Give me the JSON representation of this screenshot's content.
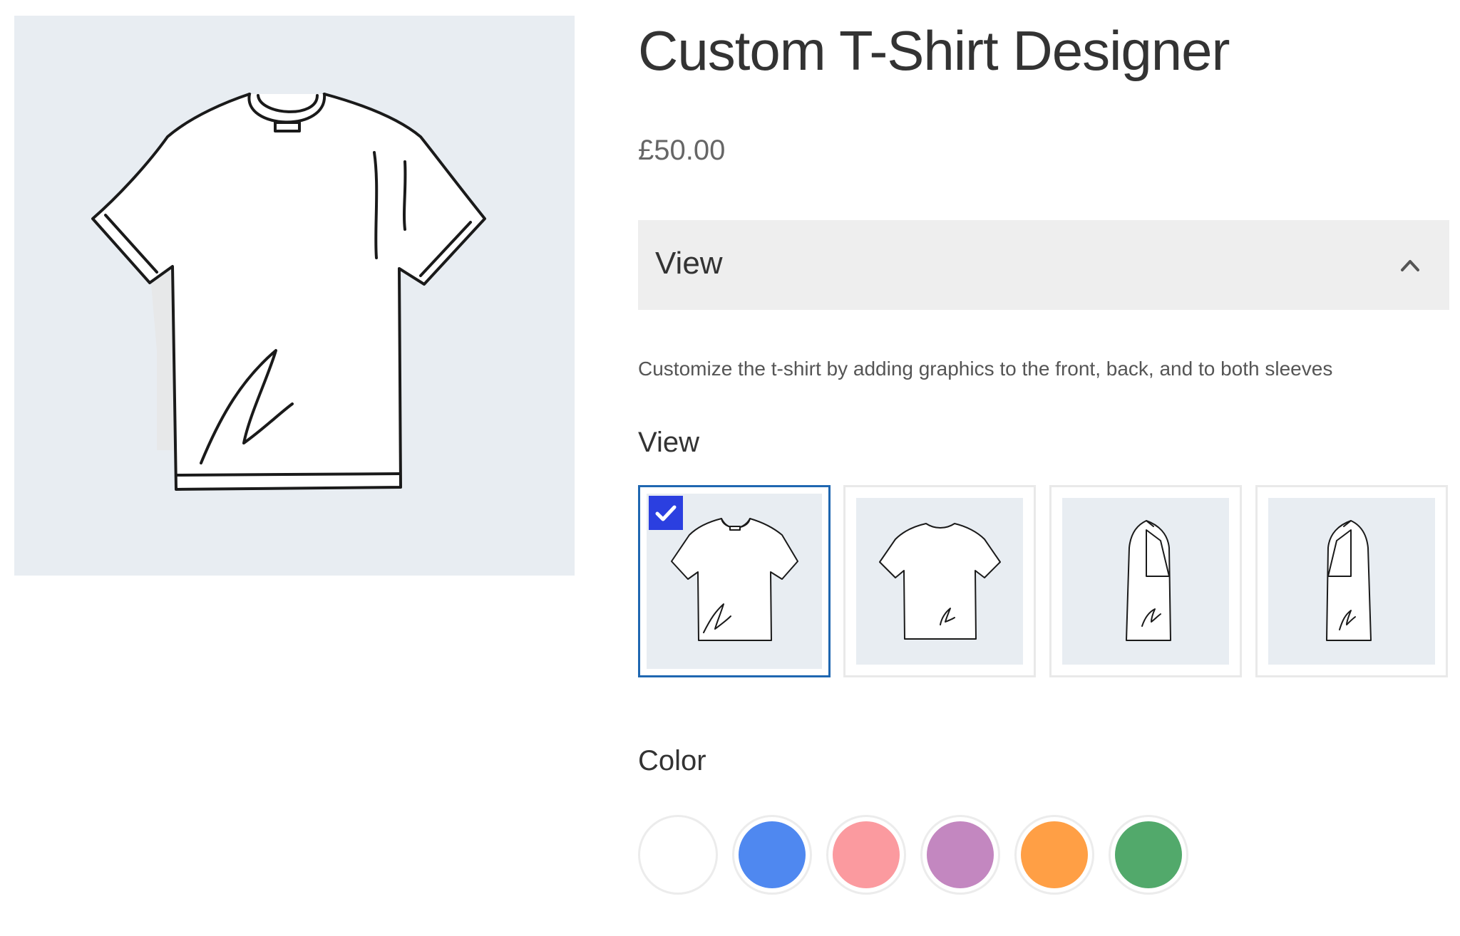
{
  "product": {
    "title": "Custom T-Shirt Designer",
    "price": "£50.00",
    "description": "Customize the t-shirt by adding graphics to the front, back, and to both sleeves"
  },
  "accordion": {
    "label": "View",
    "icon": "chevron-up-icon",
    "expanded": true
  },
  "view_section": {
    "label": "View",
    "options": [
      {
        "name": "front",
        "selected": true
      },
      {
        "name": "back",
        "selected": false
      },
      {
        "name": "left-sleeve",
        "selected": false
      },
      {
        "name": "right-sleeve",
        "selected": false
      }
    ],
    "selected_icon": "checkmark-icon"
  },
  "color_section": {
    "label": "Color",
    "colors": [
      "#ffffff",
      "#4f88f0",
      "#fb9a9f",
      "#c387c0",
      "#ff9f45",
      "#52a96b"
    ]
  },
  "theme": {
    "image_background": "#e8edf2",
    "selected_border": "#1f67b1",
    "check_badge": "#2b3fe0",
    "accordion_background": "#eeeeee"
  }
}
